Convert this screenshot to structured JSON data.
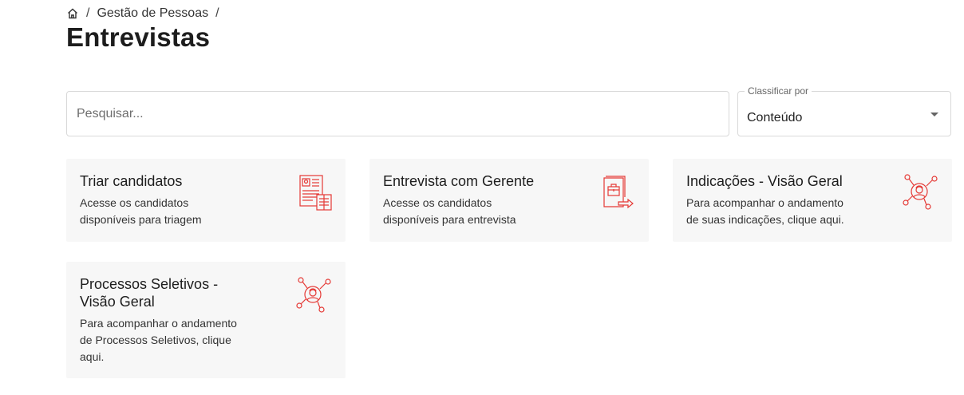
{
  "breadcrumb": {
    "home_icon": "home-icon",
    "items": [
      "Gestão de Pessoas"
    ],
    "separator": "/"
  },
  "page": {
    "title": "Entrevistas"
  },
  "search": {
    "placeholder": "Pesquisar...",
    "value": ""
  },
  "sort": {
    "label": "Classificar por",
    "value": "Conteúdo",
    "icon": "caret-down-icon"
  },
  "accent_color": "#e53935",
  "cards": [
    {
      "title": "Triar candidatos",
      "description_lines": [
        "Acesse os candidatos",
        "disponíveis para triagem"
      ],
      "icon": "resume-list-icon"
    },
    {
      "title": "Entrevista com Gerente",
      "description_lines": [
        "Acesse os candidatos",
        "disponíveis para entrevista"
      ],
      "icon": "document-briefcase-icon"
    },
    {
      "title": "Indicações - Visão Geral",
      "description_lines": [
        "Para acompanhar o andamento",
        "de suas indicações, clique aqui."
      ],
      "icon": "person-network-icon"
    },
    {
      "title_lines": [
        "Processos Seletivos -",
        "Visão Geral"
      ],
      "description_lines": [
        "Para acompanhar o andamento",
        "de Processos Seletivos, clique",
        "aqui."
      ],
      "icon": "person-network-icon"
    }
  ]
}
